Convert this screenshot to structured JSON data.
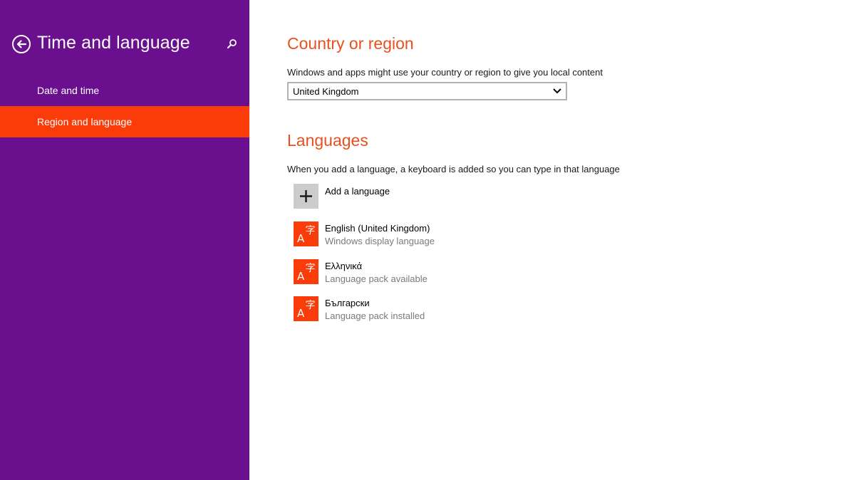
{
  "sidebar": {
    "title": "Time and language",
    "back_icon": "back-arrow-circle-icon",
    "search_icon": "search-icon",
    "items": [
      {
        "label": "Date and time",
        "selected": false
      },
      {
        "label": "Region and language",
        "selected": true
      }
    ],
    "background_color": "#6a0f8e",
    "selected_color": "#fa3b0a"
  },
  "main": {
    "country": {
      "title": "Country or region",
      "description": "Windows and apps might use your country or region to give you local content",
      "selected_value": "United Kingdom"
    },
    "languages": {
      "title": "Languages",
      "description": "When you add a language, a keyboard is added so you can type in that language",
      "add_label": "Add a language",
      "items": [
        {
          "name": "English (United Kingdom)",
          "status": "Windows display language"
        },
        {
          "name": "Ελληνικά",
          "status": "Language pack available"
        },
        {
          "name": "Български",
          "status": "Language pack installed"
        }
      ]
    },
    "accent_color": "#e8501f"
  }
}
